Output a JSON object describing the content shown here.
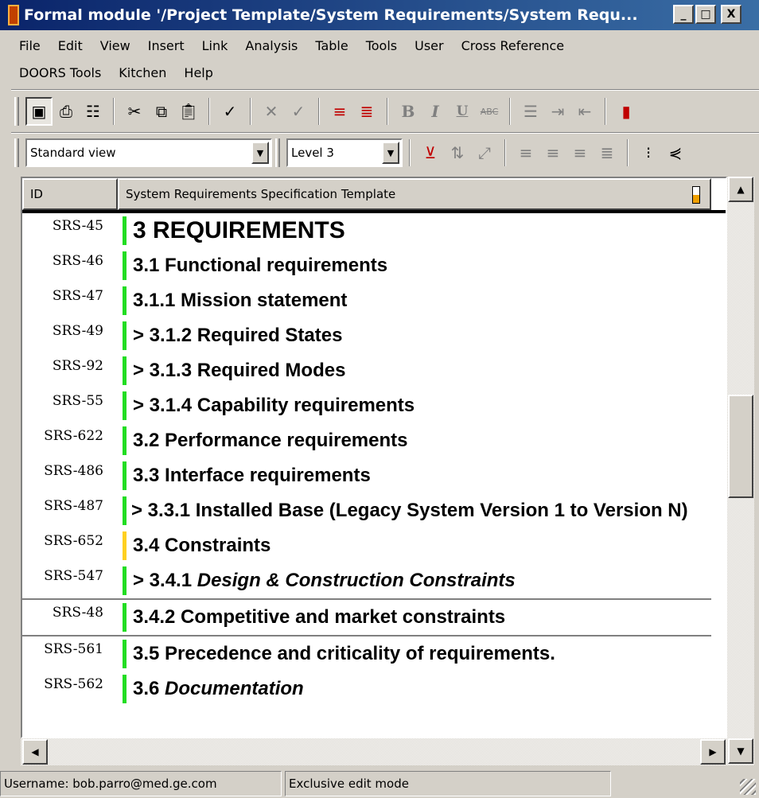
{
  "window": {
    "title": "Formal module '/Project Template/System Requirements/System Requ...",
    "min_label": "_",
    "max_label": "□",
    "close_label": "X"
  },
  "menu": {
    "row1": [
      "File",
      "Edit",
      "View",
      "Insert",
      "Link",
      "Analysis",
      "Table",
      "Tools",
      "User",
      "Cross Reference"
    ],
    "row2": [
      "DOORS Tools",
      "Kitchen",
      "Help"
    ]
  },
  "toolbar": {
    "view_select": "Standard view",
    "level_select": "Level 3",
    "icons1": [
      "save-icon",
      "print-icon",
      "properties-icon",
      "cut-icon",
      "copy-icon",
      "paste-icon",
      "spellcheck-icon",
      "reject-icon",
      "accept-icon",
      "insert-heading-icon",
      "insert-object-icon",
      "bold-icon",
      "italic-icon",
      "underline-icon",
      "strikethrough-icon",
      "bullets-icon",
      "indent-icon",
      "outdent-icon",
      "more-icon"
    ],
    "icons2": [
      "filter-icon",
      "sort-icon",
      "link-icon",
      "align-left-icon",
      "align-center-icon",
      "align-right-icon",
      "justify-icon",
      "outline-icon",
      "graph-icon"
    ],
    "bold_glyph": "B",
    "italic_glyph": "I",
    "underline_glyph": "U",
    "strike_glyph": "ABC"
  },
  "grid": {
    "col_id": "ID",
    "col_main": "System Requirements Specification Template",
    "rows": [
      {
        "id": "SRS-45",
        "text": "3 REQUIREMENTS",
        "style": "h1",
        "bar": "green"
      },
      {
        "id": "SRS-46",
        "text": "3.1 Functional requirements",
        "style": "h2",
        "bar": "green"
      },
      {
        "id": "SRS-47",
        "text": "3.1.1 Mission statement",
        "style": "h2",
        "bar": "green"
      },
      {
        "id": "SRS-49",
        "text": "> 3.1.2 Required States",
        "style": "h2",
        "bar": "green"
      },
      {
        "id": "SRS-92",
        "text": "> 3.1.3 Required Modes",
        "style": "h2",
        "bar": "green"
      },
      {
        "id": "SRS-55",
        "text": "> 3.1.4 Capability requirements",
        "style": "h2",
        "bar": "green"
      },
      {
        "id": "SRS-622",
        "text": "3.2 Performance requirements",
        "style": "h2",
        "bar": "green"
      },
      {
        "id": "SRS-486",
        "text": "3.3 Interface requirements",
        "style": "h2",
        "bar": "green"
      },
      {
        "id": "SRS-487",
        "text": "> 3.3.1 Installed Base (Legacy System Version 1 to Version N)",
        "style": "h2 wrap",
        "bar": "green"
      },
      {
        "id": "SRS-652",
        "text": "3.4 Constraints",
        "style": "h2",
        "bar": "yellow"
      },
      {
        "id": "SRS-547",
        "text": "> 3.4.1 ",
        "italic": "Design & Construction Constraints",
        "style": "h2",
        "bar": "green"
      },
      {
        "id": "SRS-48",
        "text": "3.4.2 Competitive and market constraints",
        "style": "h2",
        "bar": "green",
        "borders": "tb"
      },
      {
        "id": "SRS-561",
        "text": "3.5 Precedence and criticality of requirements.",
        "style": "h2",
        "bar": "green"
      },
      {
        "id": "SRS-562",
        "text": "3.6 ",
        "italic": "Documentation",
        "style": "h2",
        "bar": "green"
      }
    ]
  },
  "scroll": {
    "up": "▲",
    "down": "▼",
    "left": "◀",
    "right": "▶"
  },
  "status": {
    "username": "Username: bob.parro@med.ge.com",
    "mode": "Exclusive edit mode"
  },
  "colors": {
    "green_bar": "#22dd22",
    "yellow_bar": "#ffd020",
    "title_bg": "#0a246a"
  }
}
